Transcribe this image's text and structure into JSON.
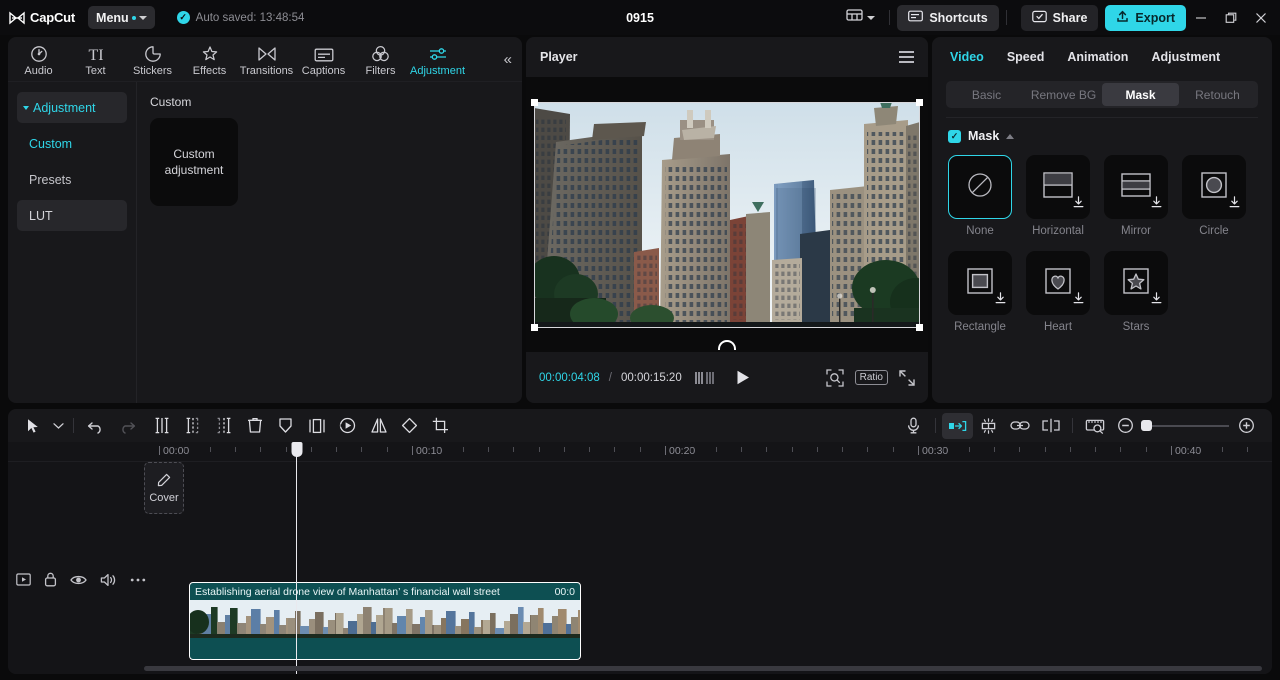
{
  "titlebar": {
    "app_name": "CapCut",
    "menu_label": "Menu",
    "autosave_text": "Auto saved: 13:48:54",
    "project_title": "0915",
    "shortcuts_label": "Shortcuts",
    "share_label": "Share",
    "export_label": "Export",
    "accent": "#2fd6e8"
  },
  "left_panel": {
    "nav_tabs": [
      {
        "label": "Audio",
        "icon": "audio-note-icon",
        "active": false
      },
      {
        "label": "Text",
        "icon": "text-ti-icon",
        "active": false
      },
      {
        "label": "Stickers",
        "icon": "sticker-icon",
        "active": false
      },
      {
        "label": "Effects",
        "icon": "effects-sparkle-icon",
        "active": false
      },
      {
        "label": "Transitions",
        "icon": "transitions-bowtie-icon",
        "active": false
      },
      {
        "label": "Captions",
        "icon": "captions-icon",
        "active": false
      },
      {
        "label": "Filters",
        "icon": "filters-circles-icon",
        "active": false
      },
      {
        "label": "Adjustment",
        "icon": "adjustment-sliders-icon",
        "active": true
      }
    ],
    "side_items": [
      {
        "label": "Adjustment",
        "style": "group"
      },
      {
        "label": "Custom",
        "style": "selected"
      },
      {
        "label": "Presets",
        "style": "plain"
      },
      {
        "label": "LUT",
        "style": "boxed"
      }
    ],
    "section_title": "Custom",
    "preset_card_label": "Custom adjustment"
  },
  "player": {
    "title": "Player",
    "current_time": "00:00:04:08",
    "time_separator": "/",
    "total_time": "00:00:15:20",
    "ratio_label": "Ratio"
  },
  "right_panel": {
    "tabs": [
      {
        "label": "Video",
        "active": true
      },
      {
        "label": "Speed",
        "active": false
      },
      {
        "label": "Animation",
        "active": false
      },
      {
        "label": "Adjustment",
        "active": false
      }
    ],
    "segments": [
      {
        "label": "Basic",
        "active": false
      },
      {
        "label": "Remove BG",
        "active": false
      },
      {
        "label": "Mask",
        "active": true
      },
      {
        "label": "Retouch",
        "active": false
      }
    ],
    "mask_section_label": "Mask",
    "mask_enabled": true,
    "masks": [
      {
        "label": "None",
        "icon": "none-slash-circle-icon",
        "selected": true,
        "downloadable": false
      },
      {
        "label": "Horizontal",
        "icon": "mask-horizontal-icon",
        "selected": false,
        "downloadable": true
      },
      {
        "label": "Mirror",
        "icon": "mask-mirror-icon",
        "selected": false,
        "downloadable": true
      },
      {
        "label": "Circle",
        "icon": "mask-circle-icon",
        "selected": false,
        "downloadable": true
      },
      {
        "label": "Rectangle",
        "icon": "mask-rectangle-icon",
        "selected": false,
        "downloadable": true
      },
      {
        "label": "Heart",
        "icon": "mask-heart-icon",
        "selected": false,
        "downloadable": true
      },
      {
        "label": "Stars",
        "icon": "mask-star-icon",
        "selected": false,
        "downloadable": true
      }
    ]
  },
  "timeline": {
    "tools_left": [
      {
        "name": "select-arrow-icon"
      },
      {
        "name": "chevron-down-icon"
      },
      {
        "name": "undo-icon"
      },
      {
        "name": "redo-icon"
      },
      {
        "name": "split-icon"
      },
      {
        "name": "trim-left-icon"
      },
      {
        "name": "trim-right-icon"
      },
      {
        "name": "delete-icon"
      },
      {
        "name": "keyframe-shield-icon"
      },
      {
        "name": "freeze-frame-icon"
      },
      {
        "name": "reverse-icon"
      },
      {
        "name": "mirror-flip-icon"
      },
      {
        "name": "rotate-icon"
      },
      {
        "name": "crop-icon"
      }
    ],
    "tools_right": [
      {
        "name": "microphone-icon"
      },
      {
        "name": "auto-fit-icon",
        "active": true
      },
      {
        "name": "adsorption-magnet-icon"
      },
      {
        "name": "link-icon"
      },
      {
        "name": "split-marker-icon"
      },
      {
        "name": "preview-scale-icon"
      },
      {
        "name": "zoom-out-icon"
      },
      {
        "name": "zoom-in-icon"
      }
    ],
    "ruler_labels": [
      "00:00",
      "00:10",
      "00:20",
      "00:30",
      "00:40"
    ],
    "track_controls": [
      {
        "name": "track-display-icon"
      },
      {
        "name": "lock-icon"
      },
      {
        "name": "eye-icon"
      },
      {
        "name": "speaker-icon"
      },
      {
        "name": "more-options-icon"
      }
    ],
    "cover_label": "Cover",
    "clip": {
      "title": "Establishing aerial drone view of Manhattan’  s financial wall street",
      "duration_partial": "00:0",
      "color": "#0d4f52"
    }
  }
}
